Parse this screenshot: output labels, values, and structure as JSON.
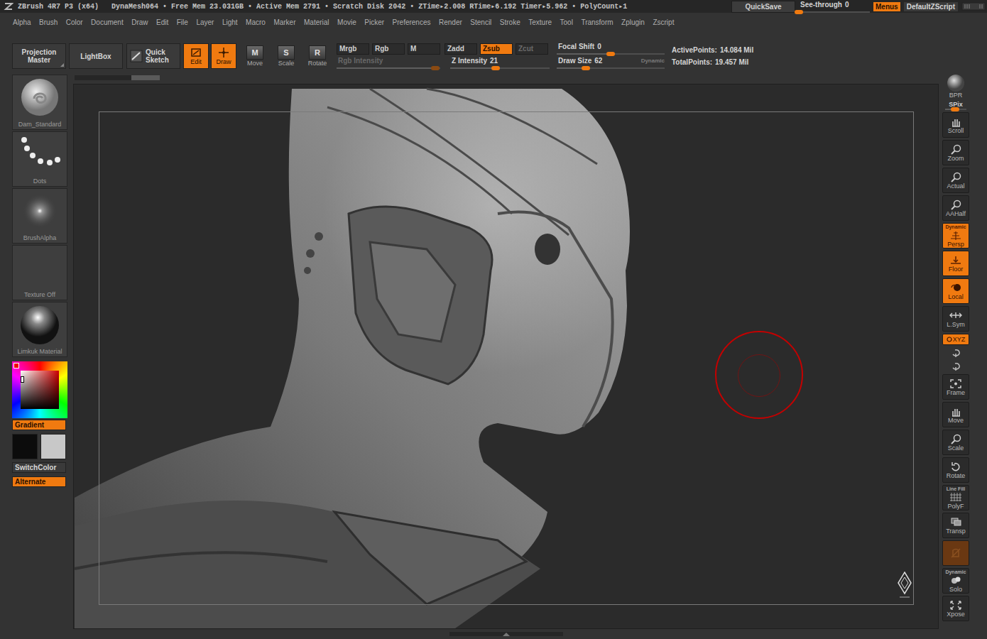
{
  "title_bar": {
    "app": "ZBrush 4R7 P3 (x64)",
    "tool": "DynaMesh064",
    "stats": [
      "• Free Mem 23.031GB",
      "• Active Mem 2791",
      "• Scratch Disk 2042",
      "• ZTime▸2.008 RTime▸6.192 Timer▸5.962",
      "• PolyCount▸1"
    ],
    "quicksave": "QuickSave",
    "see_through": {
      "label": "See-through",
      "value": "0",
      "level": 0
    },
    "menus": {
      "label": "Menus",
      "selected": true
    },
    "script": "DefaultZScript"
  },
  "menu_bar": [
    "Alpha",
    "Brush",
    "Color",
    "Document",
    "Draw",
    "Edit",
    "File",
    "Layer",
    "Light",
    "Macro",
    "Marker",
    "Material",
    "Movie",
    "Picker",
    "Preferences",
    "Render",
    "Stencil",
    "Stroke",
    "Texture",
    "Tool",
    "Transform",
    "Zplugin",
    "Zscript"
  ],
  "toolbar": {
    "projection_master": "Projection Master",
    "lightbox": "LightBox",
    "quick_sketch": "Quick Sketch",
    "modes": [
      {
        "label": "Edit",
        "selected": true
      },
      {
        "label": "Draw",
        "selected": true
      }
    ],
    "transforms": [
      {
        "label": "Move",
        "glyph": "M",
        "selected": false
      },
      {
        "label": "Scale",
        "glyph": "S",
        "selected": false
      },
      {
        "label": "Rotate",
        "glyph": "R",
        "selected": false
      }
    ],
    "color_modes": [
      {
        "label": "Mrgb",
        "selected": false
      },
      {
        "label": "Rgb",
        "selected": false
      },
      {
        "label": "M",
        "selected": false
      }
    ],
    "rgb_intensity": {
      "label": "Rgb Intensity",
      "disabled": true,
      "level": 0.95
    },
    "z_modes": [
      {
        "label": "Zadd",
        "selected": false,
        "disabled": false
      },
      {
        "label": "Zsub",
        "selected": true,
        "disabled": false
      },
      {
        "label": "Zcut",
        "selected": false,
        "disabled": true
      }
    ],
    "z_intensity": {
      "label": "Z Intensity",
      "value": "21",
      "level": 0.46
    },
    "focal_shift": {
      "label": "Focal Shift",
      "value": "0",
      "level": 0.5
    },
    "draw_size": {
      "label": "Draw Size",
      "value": "62",
      "level": 0.27,
      "dynamic": {
        "label": "Dynamic",
        "selected": false
      }
    },
    "points": [
      {
        "label": "ActivePoints:",
        "value": "14.084 Mil"
      },
      {
        "label": "TotalPoints:",
        "value": "19.457 Mil"
      }
    ]
  },
  "left_shelf": {
    "slots": [
      {
        "label": "Dam_Standard",
        "kind": "brush"
      },
      {
        "label": "Dots",
        "kind": "stroke"
      },
      {
        "label": "BrushAlpha",
        "kind": "alpha"
      },
      {
        "label": "Texture Off",
        "kind": "texture"
      },
      {
        "label": "Limkuk Material",
        "kind": "material"
      }
    ],
    "gradient": {
      "label": "Gradient",
      "selected": true
    },
    "swatches": [
      {
        "name": "main",
        "color": "#0c0c0c"
      },
      {
        "name": "secondary",
        "color": "#c8c8c8"
      }
    ],
    "switch_color": "SwitchColor",
    "alternate": {
      "label": "Alternate",
      "selected": true
    }
  },
  "right_shelf": [
    {
      "label": "BPR",
      "kind": "render",
      "selected": false,
      "disabled": false
    },
    {
      "label": "SPix",
      "kind": "slider",
      "level": 0.45,
      "selected": false,
      "disabled": false
    },
    {
      "label": "Scroll",
      "kind": "button",
      "selected": false,
      "disabled": false
    },
    {
      "label": "Zoom",
      "kind": "button",
      "selected": false,
      "disabled": false
    },
    {
      "label": "Actual",
      "kind": "button",
      "selected": false,
      "disabled": false
    },
    {
      "label": "AAHalf",
      "kind": "button",
      "selected": false,
      "disabled": false
    },
    {
      "label": "Persp",
      "caption": "Dynamic",
      "kind": "button",
      "selected": true,
      "disabled": false
    },
    {
      "label": "Floor",
      "kind": "button",
      "selected": true,
      "disabled": false
    },
    {
      "label": "Local",
      "kind": "button",
      "selected": true,
      "disabled": false
    },
    {
      "label": "L.Sym",
      "kind": "button",
      "selected": false,
      "disabled": false
    },
    {
      "label": "XYZ",
      "kind": "small",
      "selected": true,
      "disabled": false
    },
    {
      "kind": "rotate",
      "selected": false,
      "disabled": false
    },
    {
      "kind": "rotate",
      "selected": false,
      "disabled": false
    },
    {
      "label": "Frame",
      "kind": "button",
      "selected": false,
      "disabled": false
    },
    {
      "label": "Move",
      "kind": "button",
      "selected": false,
      "disabled": false
    },
    {
      "label": "Scale",
      "kind": "button",
      "selected": false,
      "disabled": false
    },
    {
      "label": "Rotate",
      "kind": "button",
      "selected": false,
      "disabled": false
    },
    {
      "label": "PolyF",
      "caption": "Line Fill",
      "kind": "button",
      "selected": false,
      "disabled": false
    },
    {
      "label": "Transp",
      "kind": "button",
      "selected": false,
      "disabled": false
    },
    {
      "kind": "ghost",
      "selected": true,
      "disabled": true
    },
    {
      "label": "Solo",
      "caption": "Dynamic",
      "kind": "button",
      "selected": false,
      "disabled": false
    },
    {
      "label": "Xpose",
      "kind": "button",
      "selected": false,
      "disabled": false
    }
  ]
}
